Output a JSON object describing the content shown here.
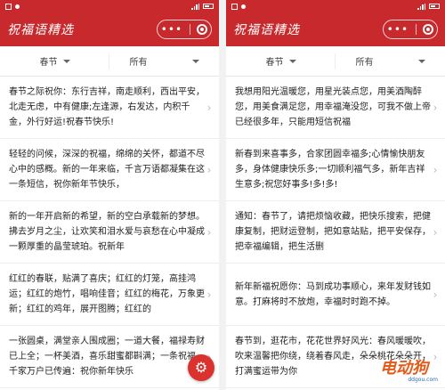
{
  "status": {
    "time": ""
  },
  "app": {
    "title": "祝福语精选",
    "more_label": "•••"
  },
  "panels": [
    {
      "filters": [
        {
          "label": "春节"
        },
        {
          "label": "所有"
        }
      ],
      "items": [
        {
          "text": "春节之际祝你：东行吉祥，南走顺利，西出平安，北走无虑，中有健康;左逢源，右发达，内积千金，外行好运!祝春节快乐!"
        },
        {
          "text": "轻轻的问候，深深的祝福，绵绵的关怀，都道不尽心中的感概。新的一年来临，千言万语都凝集在这一条短信，祝你新年节快乐，"
        },
        {
          "text": "新的一年开启新的希望，新的空白承载新的梦想。拂去岁月之尘，让欢笑和泪水爱与哀愁在心中凝成一颗厚重的晶莹琥珀。祝新年"
        },
        {
          "text": "红红的春联，贴满了喜庆；红红的灯笼，高挂鸿运；红红的炮竹，唱响佳音；红红的梅花，万象更新；红红的鸡年，展开图腾；红红的"
        },
        {
          "text": "一张圆桌，满堂亲人围成圈；一道大餐，福禄寿财已上全；一杯美酒，喜乐甜蜜都斟满；一条祝福，千家万户已传遍：祝你新年快乐"
        }
      ]
    },
    {
      "filters": [
        {
          "label": "春节"
        },
        {
          "label": "所有"
        }
      ],
      "items": [
        {
          "text": "我想用阳光温暖您，用星光装点您，用美酒陶醉您，用美食满足您，用幸福淹没您，可我不做上帝已经很多年，只能用短信祝福"
        },
        {
          "text": "新春到来喜事多，合家团圆幸福多;心情愉快朋友多，身体健康快乐多;一切顺利福气多，新年吉祥生意多;祝您好事多!多!多!"
        },
        {
          "text": "通知：春节了，请把烦恼收藏，把快乐搜索，把健康复制，把财运登制，把如意站贴，把平安保存，把幸福编辑，把生活删"
        },
        {
          "text": "新年新福祝愿你：马到成功事顺心，来年发财钱如意。打麻将时不放炮，幸福时时跑不掉。"
        },
        {
          "text": "春节到，逛花市，花花世界好风光：春风暖暖吹，吹来温馨把你绕，绕着春风走，朵朵桃花朵朵开，打满蜜运带为你"
        }
      ]
    }
  ],
  "fab": {
    "icon": "gear-icon"
  },
  "watermark": {
    "text": "电动狗",
    "sub": "ddgou.com"
  },
  "colors": {
    "primary": "#c8292c",
    "fab": "#d9322f"
  }
}
